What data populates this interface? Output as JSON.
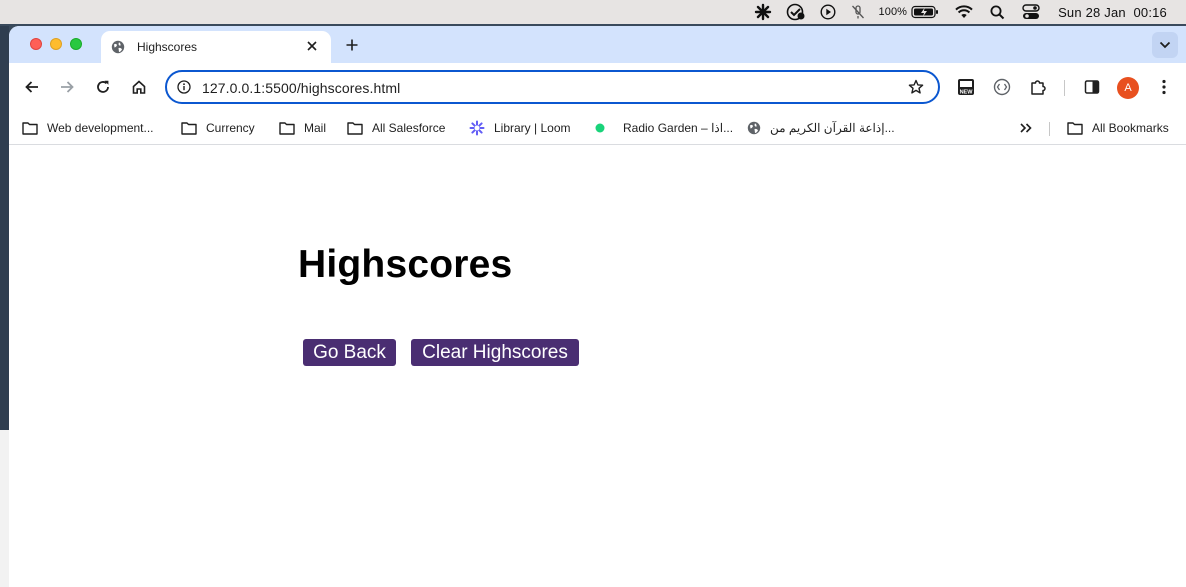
{
  "menubar": {
    "icons": [
      "flower-status-icon",
      "check-badge-icon",
      "play-circle-icon",
      "mic-off-icon",
      "battery-charging-icon",
      "wifi-icon",
      "spotlight-search-icon",
      "control-center-icon"
    ],
    "battery_percent": "100%",
    "clock": "Sun 28 Jan  00:16"
  },
  "tab": {
    "title": "Highscores",
    "favicon": "globe-icon"
  },
  "toolbar": {
    "url": "127.0.0.1:5500/highscores.html",
    "extensions": [
      "news-extension-icon",
      "code-extension-icon",
      "puzzle-extensions-icon"
    ],
    "profile_initial": "A"
  },
  "bookmarks": {
    "items": [
      {
        "label": "Web development...",
        "icon": "folder-icon"
      },
      {
        "label": "Currency",
        "icon": "folder-icon"
      },
      {
        "label": "Mail",
        "icon": "folder-icon"
      },
      {
        "label": "All Salesforce",
        "icon": "folder-icon"
      },
      {
        "label": "Library | Loom",
        "icon": "loom-icon"
      },
      {
        "label": "Radio Garden – اذا...",
        "icon": "radio-dot-icon"
      },
      {
        "label": "إذاعة القرآن الكريم من...",
        "icon": "globe-icon"
      }
    ],
    "overflow_icon": "chevron-double-right-icon",
    "all_bookmarks": "All Bookmarks"
  },
  "page": {
    "heading": "Highscores",
    "go_back_label": "Go Back",
    "clear_label": "Clear Highscores"
  },
  "colors": {
    "accent_button": "#4a2e72",
    "omnibox_border": "#0b57d0",
    "tabstrip": "#d3e3fd",
    "avatar": "#e8501f"
  }
}
